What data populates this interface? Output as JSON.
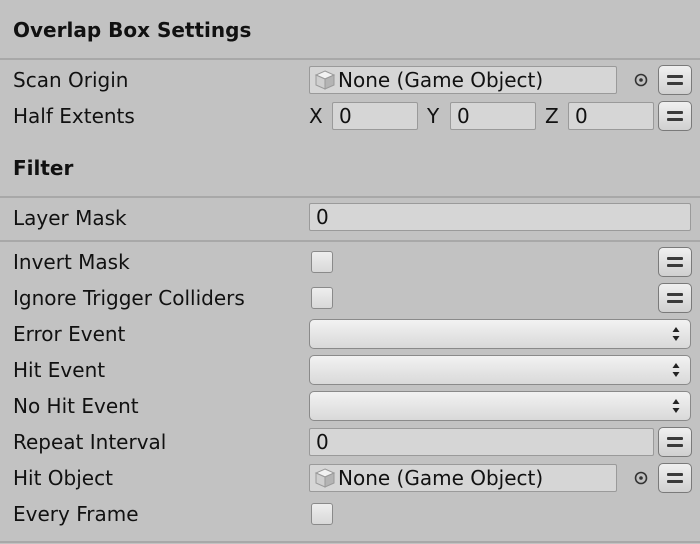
{
  "sections": {
    "overlap_box": "Overlap Box Settings",
    "filter": "Filter"
  },
  "scan_origin": {
    "label": "Scan Origin",
    "value": "None (Game Object)"
  },
  "half_extents": {
    "label": "Half Extents",
    "x_label": "X",
    "x": "0",
    "y_label": "Y",
    "y": "0",
    "z_label": "Z",
    "z": "0"
  },
  "layer_mask": {
    "label": "Layer Mask",
    "value": "0"
  },
  "invert_mask": {
    "label": "Invert Mask",
    "checked": false
  },
  "ignore_trigger": {
    "label": "Ignore Trigger Colliders",
    "checked": false
  },
  "error_event": {
    "label": "Error Event",
    "value": ""
  },
  "hit_event": {
    "label": "Hit Event",
    "value": ""
  },
  "no_hit_event": {
    "label": "No Hit Event",
    "value": ""
  },
  "repeat_interval": {
    "label": "Repeat Interval",
    "value": "0"
  },
  "hit_object": {
    "label": "Hit Object",
    "value": "None (Game Object)"
  },
  "every_frame": {
    "label": "Every Frame",
    "checked": false
  },
  "icons": {
    "menu": "menu-lines-icon",
    "picker": "object-picker-icon",
    "cube": "game-object-cube-icon",
    "dropdown": "dropdown-arrows-icon"
  },
  "colors": {
    "background": "#c2c2c2",
    "field": "#d6d6d6",
    "divider": "#a8a8a8"
  }
}
